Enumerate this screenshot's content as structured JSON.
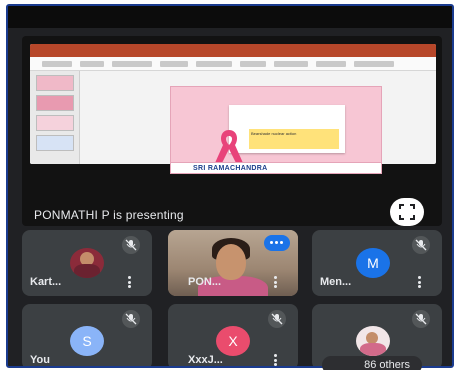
{
  "presentation": {
    "presenting_label": "PONMATHI P is presenting",
    "slide_logo_text": "SRI RAMACHANDRA",
    "slide_note": "Bearshade nuclear action"
  },
  "participants": [
    {
      "name": "Kart...",
      "avatar_type": "photo",
      "muted": true
    },
    {
      "name": "PON...",
      "avatar_type": "video",
      "muted": false,
      "speaking": true
    },
    {
      "name": "Men...",
      "avatar_type": "letter",
      "initial": "M",
      "avatar_color": "#1a73e8",
      "muted": true
    },
    {
      "name": "You",
      "avatar_type": "letter",
      "initial": "S",
      "avatar_color": "#8ab4f8",
      "muted": true
    },
    {
      "name": "XxxJ...",
      "avatar_type": "letter",
      "initial": "X",
      "avatar_color": "#ea4c6d",
      "muted": true
    },
    {
      "name": "",
      "avatar_type": "photo",
      "muted": true
    }
  ],
  "others_label": "86 others",
  "colors": {
    "background": "#202124",
    "tile": "#3c4043",
    "accent": "#1a73e8"
  },
  "icons": {
    "fullscreen": "fullscreen-icon",
    "mic_off": "mic-off-icon",
    "more": "more-vert-icon",
    "speaking": "speaking-indicator-icon"
  }
}
